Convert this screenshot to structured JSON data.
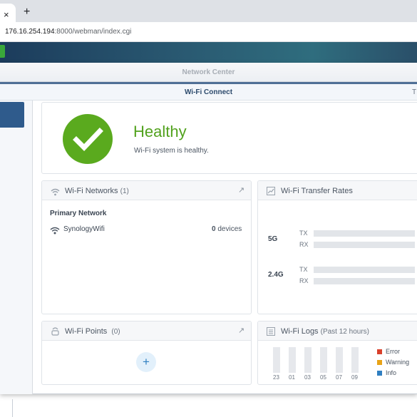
{
  "browser": {
    "tab_close": "×",
    "new_tab": "+",
    "url_host": "176.16.254.194",
    "url_rest": ":8000/webman/index.cgi"
  },
  "window": {
    "title": "Network Center",
    "subtitle": "Wi-Fi Connect",
    "subtitle_trailing": "T"
  },
  "health": {
    "status": "Healthy",
    "description": "Wi-Fi system is healthy.",
    "status_color": "#52a21e"
  },
  "networks": {
    "title": "Wi-Fi Networks",
    "count": "(1)",
    "section": "Primary Network",
    "items": [
      {
        "name": "SynologyWifi",
        "device_count": "0",
        "device_unit": "devices"
      }
    ]
  },
  "rates": {
    "title": "Wi-Fi Transfer Rates",
    "bands": [
      {
        "label": "5G",
        "tx": "TX",
        "rx": "RX"
      },
      {
        "label": "2.4G",
        "tx": "TX",
        "rx": "RX"
      }
    ]
  },
  "points": {
    "title": "Wi-Fi Points",
    "count": "(0)",
    "add_label": "+"
  },
  "logs": {
    "title": "Wi-Fi Logs",
    "range": "(Past 12 hours)",
    "ticks": [
      "23",
      "01",
      "03",
      "05",
      "07",
      "09"
    ],
    "legend": [
      {
        "label": "Error",
        "color": "#d9402b"
      },
      {
        "label": "Warning",
        "color": "#e8a317"
      },
      {
        "label": "Info",
        "color": "#2f7fc1"
      }
    ]
  }
}
